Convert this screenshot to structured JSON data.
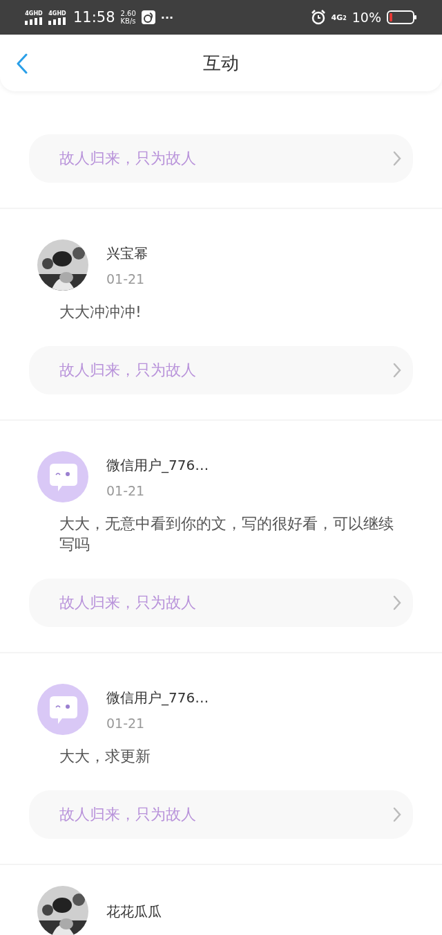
{
  "status_bar": {
    "signals": [
      "4GHD",
      "4GHD"
    ],
    "time": "11:58",
    "speed_value": "2.60",
    "speed_unit": "KB/s",
    "more": "···",
    "network": "4G",
    "network_sub": "2",
    "battery": "10%"
  },
  "header": {
    "title": "互动"
  },
  "items": [
    {
      "kind": "link_only",
      "link": "故人归来，只为故人"
    },
    {
      "kind": "comment",
      "name": "兴宝幂",
      "date": "01-21",
      "text": "大大冲冲冲!",
      "link": "故人归来，只为故人"
    },
    {
      "kind": "comment",
      "avatar": {
        "kind": "default"
      },
      "name": "微信用户_776…",
      "date": "01-21",
      "text": "大大，无意中看到你的文，写的很好看，可以继续写吗",
      "link": "故人归来，只为故人"
    },
    {
      "kind": "comment",
      "avatar": {
        "kind": "default"
      },
      "name": "微信用户_776…",
      "date": "01-21",
      "text": "大大，求更新",
      "link": "故人归来，只为故人"
    },
    {
      "kind": "comment",
      "name": "花花瓜瓜"
    }
  ]
}
